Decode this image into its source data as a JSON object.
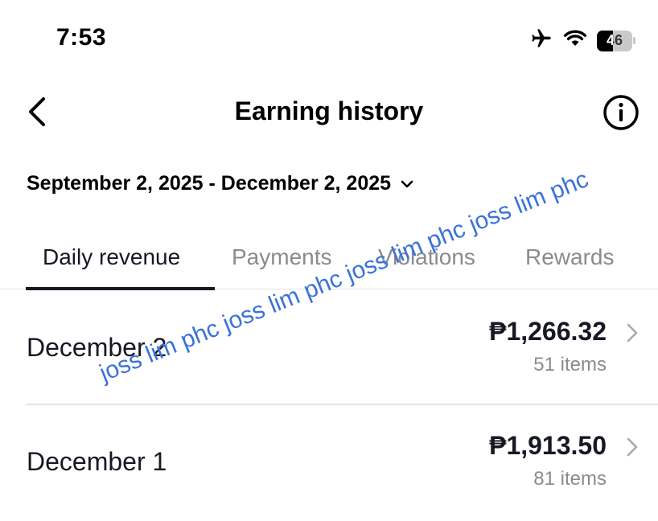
{
  "status_bar": {
    "time": "7:53",
    "battery_level": "46",
    "battery_fraction": 0.46,
    "icons": [
      "airplane-icon",
      "wifi-icon",
      "battery-icon"
    ]
  },
  "header": {
    "title": "Earning history",
    "back_icon": "chevron-left-icon",
    "info_icon": "info-icon"
  },
  "date_range": {
    "label": "September 2, 2025 - December 2, 2025",
    "icon": "chevron-down-icon"
  },
  "tabs": [
    {
      "label": "Daily revenue",
      "active": true
    },
    {
      "label": "Payments",
      "active": false
    },
    {
      "label": "Violations",
      "active": false
    },
    {
      "label": "Rewards",
      "active": false
    }
  ],
  "revenue_rows": [
    {
      "date": "December 2",
      "amount": "₱1,266.32",
      "items": "51 items"
    },
    {
      "date": "December 1",
      "amount": "₱1,913.50",
      "items": "81 items"
    }
  ],
  "watermark": "joss lim phc joss lim phc joss lim phc joss lim phc",
  "colors": {
    "text_primary": "#161823",
    "text_secondary": "#8a8b91",
    "divider": "#e3e3e4",
    "watermark": "#3a73d6"
  }
}
